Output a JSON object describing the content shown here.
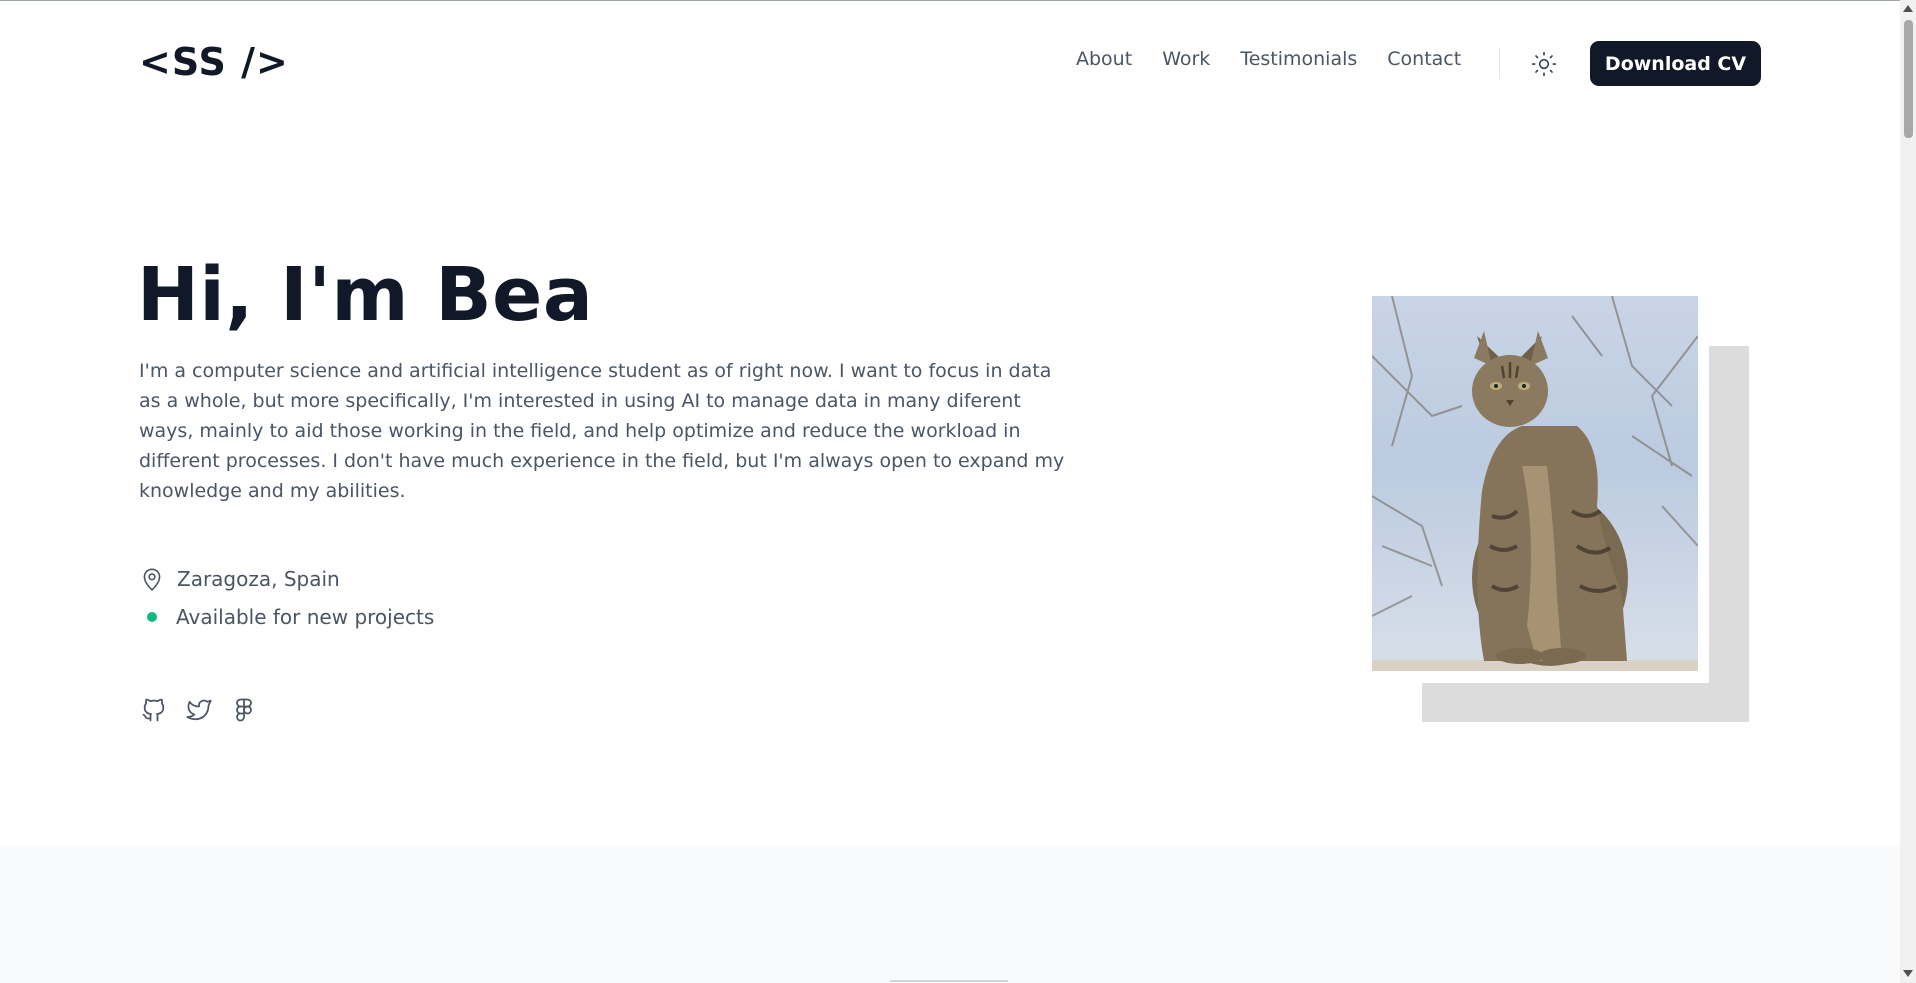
{
  "header": {
    "logo": "<SS />",
    "nav": [
      {
        "label": "About"
      },
      {
        "label": "Work"
      },
      {
        "label": "Testimonials"
      },
      {
        "label": "Contact"
      }
    ],
    "theme_icon": "sun-icon",
    "cv_button": "Download CV"
  },
  "hero": {
    "title": "Hi, I'm Bea",
    "description": "I'm a computer science and artificial intelligence student as of right now. I want to focus in data as a whole, but more specifically, I'm interested in using AI to manage data in many diferent ways, mainly to aid those working in the field, and help optimize and reduce the workload in different processes. I don't have much experience in the field, but I'm always open to expand my knowledge and my abilities.",
    "location": "Zaragoza, Spain",
    "availability": "Available for new projects",
    "status_color": "#10b981",
    "socials": [
      "github-icon",
      "twitter-icon",
      "figma-icon"
    ]
  },
  "colors": {
    "primary_dark": "#111827",
    "text_muted": "#4b5563",
    "section_bg": "#f8fafc"
  }
}
